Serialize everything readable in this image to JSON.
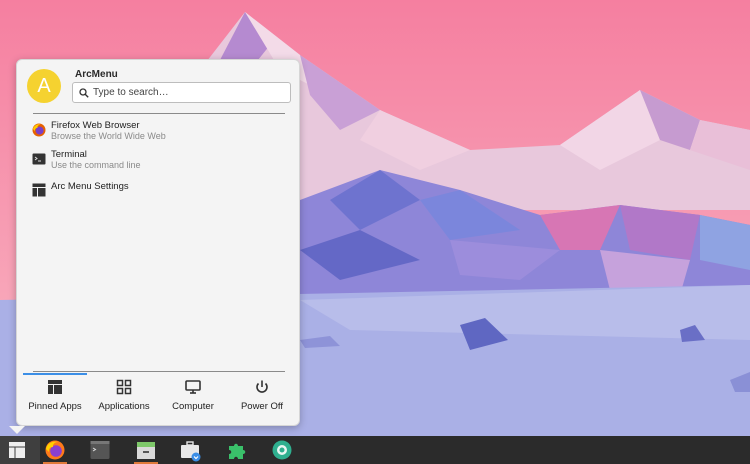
{
  "user": {
    "avatar_letter": "A",
    "name": "ArcMenu"
  },
  "search": {
    "placeholder": "Type to search…",
    "value": ""
  },
  "pinned_apps": [
    {
      "name": "Firefox Web Browser",
      "description": "Browse the World Wide Web",
      "icon": "firefox-icon"
    },
    {
      "name": "Terminal",
      "description": "Use the command line",
      "icon": "terminal-icon"
    },
    {
      "name": "Arc Menu Settings",
      "description": "",
      "icon": "arc-menu-settings-icon"
    }
  ],
  "tabs": [
    {
      "label": "Pinned Apps",
      "icon": "pinned-apps-icon",
      "active": true
    },
    {
      "label": "Applications",
      "icon": "applications-grid-icon",
      "active": false
    },
    {
      "label": "Computer",
      "icon": "computer-monitor-icon",
      "active": false
    },
    {
      "label": "Power Off",
      "icon": "power-icon",
      "active": false
    }
  ],
  "taskbar": [
    {
      "name": "arc-menu-button",
      "icon": "arc-menu-icon"
    },
    {
      "name": "firefox",
      "icon": "firefox-icon",
      "running": true
    },
    {
      "name": "terminal",
      "icon": "terminal-icon"
    },
    {
      "name": "file-manager",
      "icon": "file-cabinet-icon",
      "running": true
    },
    {
      "name": "software-installer",
      "icon": "briefcase-download-icon"
    },
    {
      "name": "extensions",
      "icon": "puzzle-icon"
    },
    {
      "name": "screenshot",
      "icon": "camera-shutter-icon"
    }
  ],
  "colors": {
    "accent": "#3b8ee6",
    "taskbar": "#2b2b2b",
    "avatar": "#f5d230",
    "running_indicator": "#e07a3a"
  }
}
